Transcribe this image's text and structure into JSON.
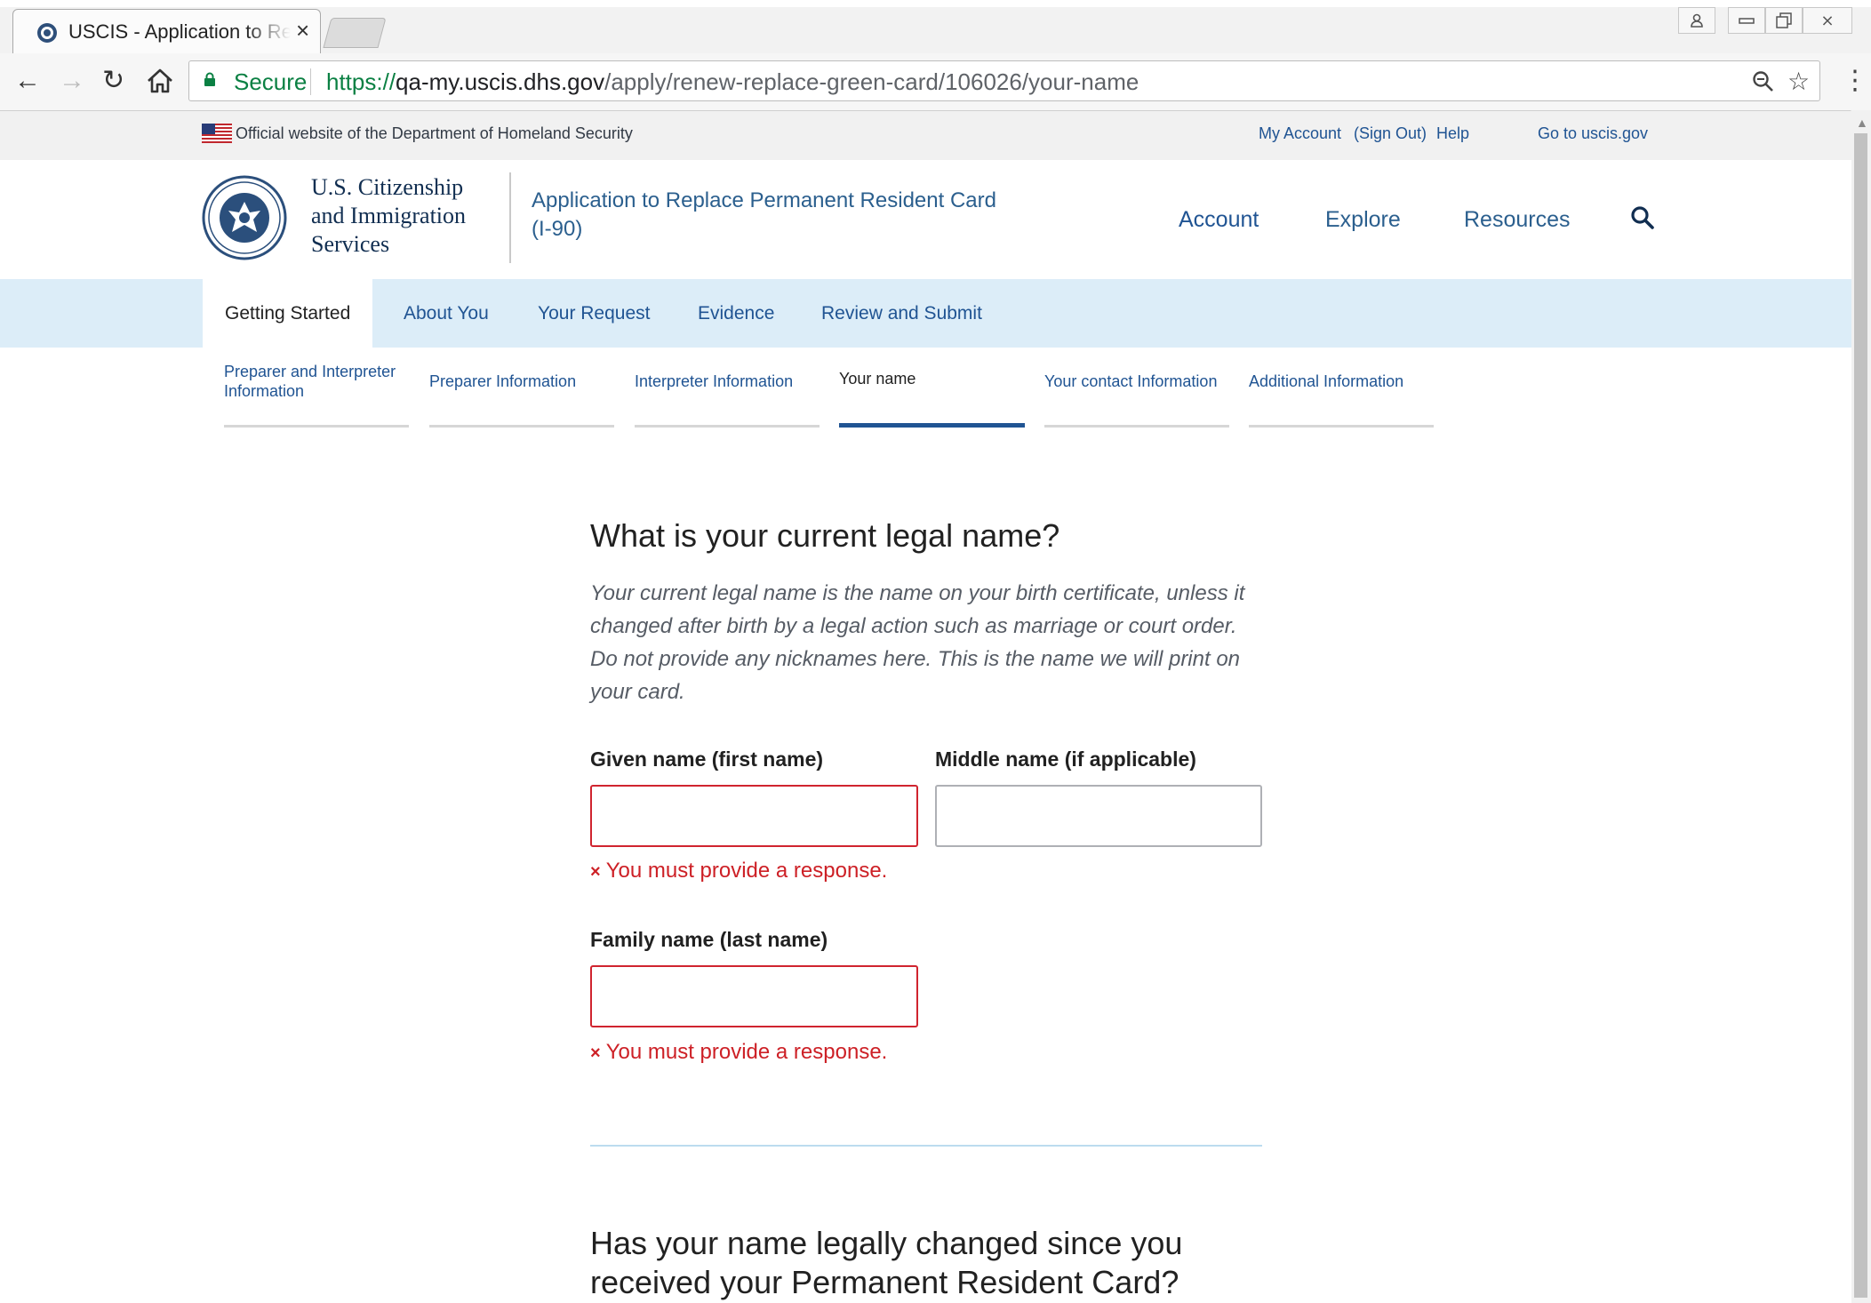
{
  "browser": {
    "tab_title": "USCIS - Application to Re",
    "secure_label": "Secure",
    "url_scheme": "https://",
    "url_host": "qa-my.uscis.dhs.gov",
    "url_path": "/apply/renew-replace-green-card/106026/your-name"
  },
  "banner": {
    "official_text": "Official website of the Department of Homeland Security",
    "my_account": "My Account",
    "sign_out": "(Sign Out)",
    "help": "Help",
    "go_to": "Go to uscis.gov"
  },
  "header": {
    "agency_line1": "U.S. Citizenship",
    "agency_line2": "and Immigration",
    "agency_line3": "Services",
    "app_title": "Application to Replace Permanent Resident Card (I-90)",
    "nav": [
      "Account",
      "Explore",
      "Resources"
    ]
  },
  "steps": [
    "Getting Started",
    "About You",
    "Your Request",
    "Evidence",
    "Review and Submit"
  ],
  "substeps": [
    "Preparer and Interpreter Information",
    "Preparer Information",
    "Interpreter Information",
    "Your name",
    "Your contact Information",
    "Additional Information"
  ],
  "form": {
    "question": "What is your current legal name?",
    "help_text": "Your current legal name is the name on your birth certificate, unless it changed after birth by a legal action such as marriage or court order. Do not provide any nicknames here. This is the name we will print on your card.",
    "given_label": "Given name (first name)",
    "middle_label": "Middle name (if applicable)",
    "family_label": "Family name (last name)",
    "given_value": "",
    "middle_value": "",
    "family_value": "",
    "error_text": "You must provide a response.",
    "error_icon": "×",
    "next_question": "Has your name legally changed since you received your Permanent Resident Card?"
  },
  "colors": {
    "link_blue": "#205493",
    "error_red": "#cd2026",
    "step_bg": "#dcedf8"
  }
}
